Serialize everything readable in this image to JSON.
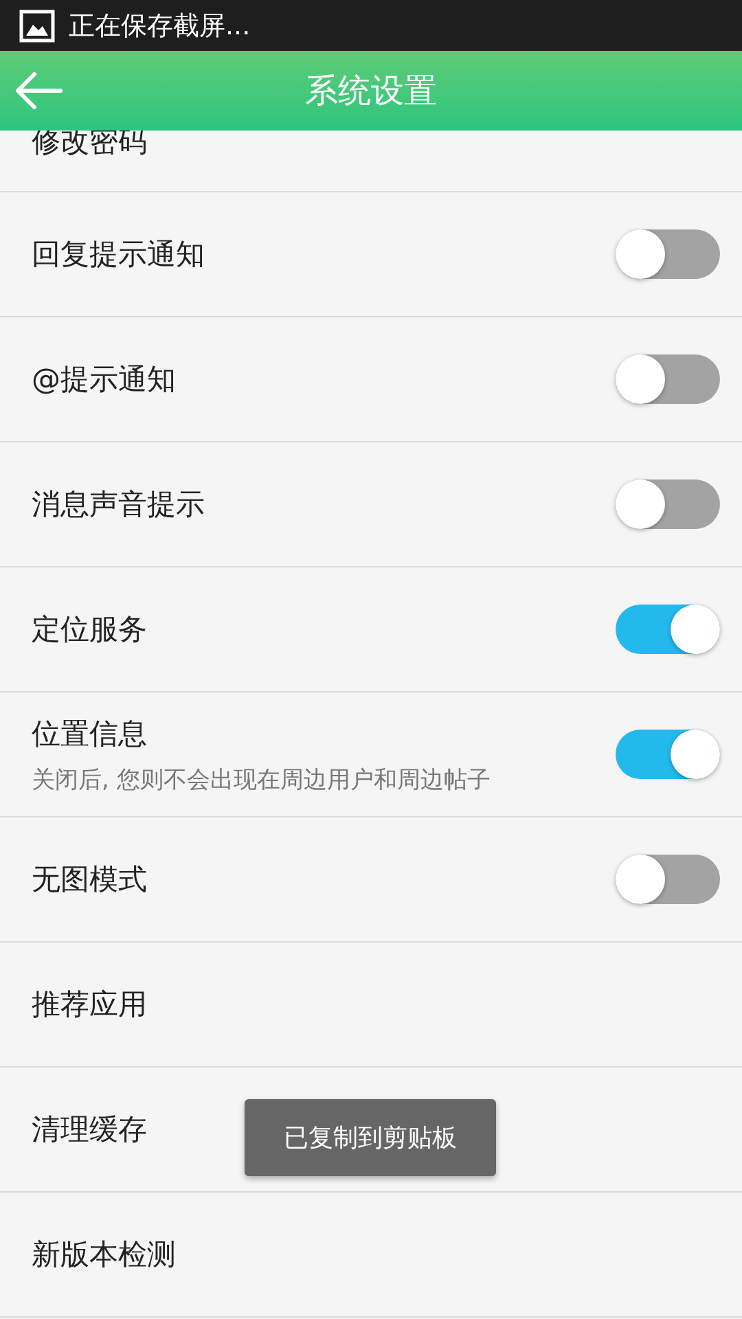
{
  "status_bar": {
    "notification": "正在保存截屏..."
  },
  "header": {
    "title": "系统设置"
  },
  "settings": [
    {
      "kind": "cut",
      "label": "修改密码"
    },
    {
      "kind": "toggle",
      "label": "回复提示通知",
      "on": false
    },
    {
      "kind": "toggle",
      "label": "@提示通知",
      "on": false
    },
    {
      "kind": "toggle",
      "label": "消息声音提示",
      "on": false
    },
    {
      "kind": "toggle",
      "label": "定位服务",
      "on": true
    },
    {
      "kind": "toggle",
      "label": "位置信息",
      "on": true,
      "description": "关闭后, 您则不会出现在周边用户和周边帖子"
    },
    {
      "kind": "toggle",
      "label": "无图模式",
      "on": false
    },
    {
      "kind": "plain",
      "label": "推荐应用"
    },
    {
      "kind": "plain",
      "label": "清理缓存"
    },
    {
      "kind": "plain",
      "label": "新版本检测"
    }
  ],
  "toast": "已复制到剪贴板"
}
